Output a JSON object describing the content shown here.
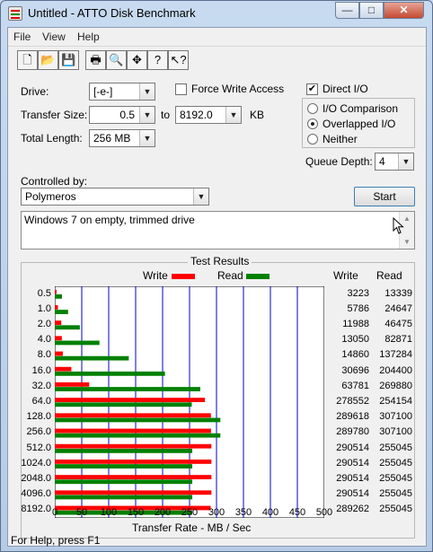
{
  "window": {
    "title": "Untitled - ATTO Disk Benchmark"
  },
  "menu": [
    "File",
    "View",
    "Help"
  ],
  "toolbar": [
    {
      "name": "new-document-icon",
      "glyph": "🗋"
    },
    {
      "name": "open-folder-icon",
      "glyph": "📂"
    },
    {
      "name": "save-icon",
      "glyph": "💾"
    },
    {
      "name": "print-icon",
      "glyph": "🖶"
    },
    {
      "name": "print-preview-icon",
      "glyph": "🔍"
    },
    {
      "name": "move-icon",
      "glyph": "✥"
    },
    {
      "name": "help-icon",
      "glyph": "?"
    },
    {
      "name": "context-help-icon",
      "glyph": "↖?"
    }
  ],
  "settings": {
    "drive_label": "Drive:",
    "drive_value": "[-e-]",
    "force_write_label": "Force Write Access",
    "force_write_checked": false,
    "direct_io_label": "Direct I/O",
    "direct_io_checked": true,
    "transfer_size_label": "Transfer Size:",
    "transfer_from": "0.5",
    "to_label": "to",
    "transfer_to": "8192.0",
    "kb_label": "KB",
    "total_length_label": "Total Length:",
    "total_length_value": "256 MB",
    "io_comparison_label": "I/O Comparison",
    "overlapped_io_label": "Overlapped I/O",
    "neither_label": "Neither",
    "selected_mode": "Overlapped I/O",
    "queue_depth_label": "Queue Depth:",
    "queue_depth_value": "4",
    "controlled_by_label": "Controlled by:",
    "controlled_by_value": "Polymeros",
    "start_label": "Start",
    "notes": "Windows 7 on empty, trimmed drive"
  },
  "results": {
    "title": "Test Results",
    "write_legend": "Write",
    "read_legend": "Read",
    "col_write": "Write",
    "col_read": "Read",
    "x_axis_title": "Transfer Rate - MB / Sec"
  },
  "colors": {
    "write": "#ff0000",
    "read": "#008000",
    "grid": "#0000c8"
  },
  "chart_data": {
    "type": "bar",
    "orientation": "horizontal",
    "title": "Test Results",
    "xlabel": "Transfer Rate - MB / Sec",
    "xlim": [
      0,
      500
    ],
    "xticks": [
      0,
      50,
      100,
      150,
      200,
      250,
      300,
      350,
      400,
      450,
      500
    ],
    "categories": [
      "0.5",
      "1.0",
      "2.0",
      "4.0",
      "8.0",
      "16.0",
      "32.0",
      "64.0",
      "128.0",
      "256.0",
      "512.0",
      "1024.0",
      "2048.0",
      "4096.0",
      "8192.0"
    ],
    "series": [
      {
        "name": "Write",
        "values": [
          3.223,
          5.786,
          11.988,
          13.05,
          14.86,
          30.696,
          63.781,
          278.552,
          289.618,
          289.78,
          290.514,
          290.514,
          290.514,
          290.514,
          289.262
        ]
      },
      {
        "name": "Read",
        "values": [
          13.339,
          24.647,
          46.475,
          82.871,
          137.284,
          204.4,
          269.88,
          254.154,
          307.1,
          307.1,
          255.045,
          255.045,
          255.045,
          255.045,
          255.045
        ]
      }
    ],
    "table": {
      "write": [
        "3223",
        "5786",
        "11988",
        "13050",
        "14860",
        "30696",
        "63781",
        "278552",
        "289618",
        "289780",
        "290514",
        "290514",
        "290514",
        "290514",
        "289262"
      ],
      "read": [
        "13339",
        "24647",
        "46475",
        "82871",
        "137284",
        "204400",
        "269880",
        "254154",
        "307100",
        "307100",
        "255045",
        "255045",
        "255045",
        "255045",
        "255045"
      ]
    },
    "legend": "top"
  },
  "status": {
    "text": "For Help, press F1"
  }
}
